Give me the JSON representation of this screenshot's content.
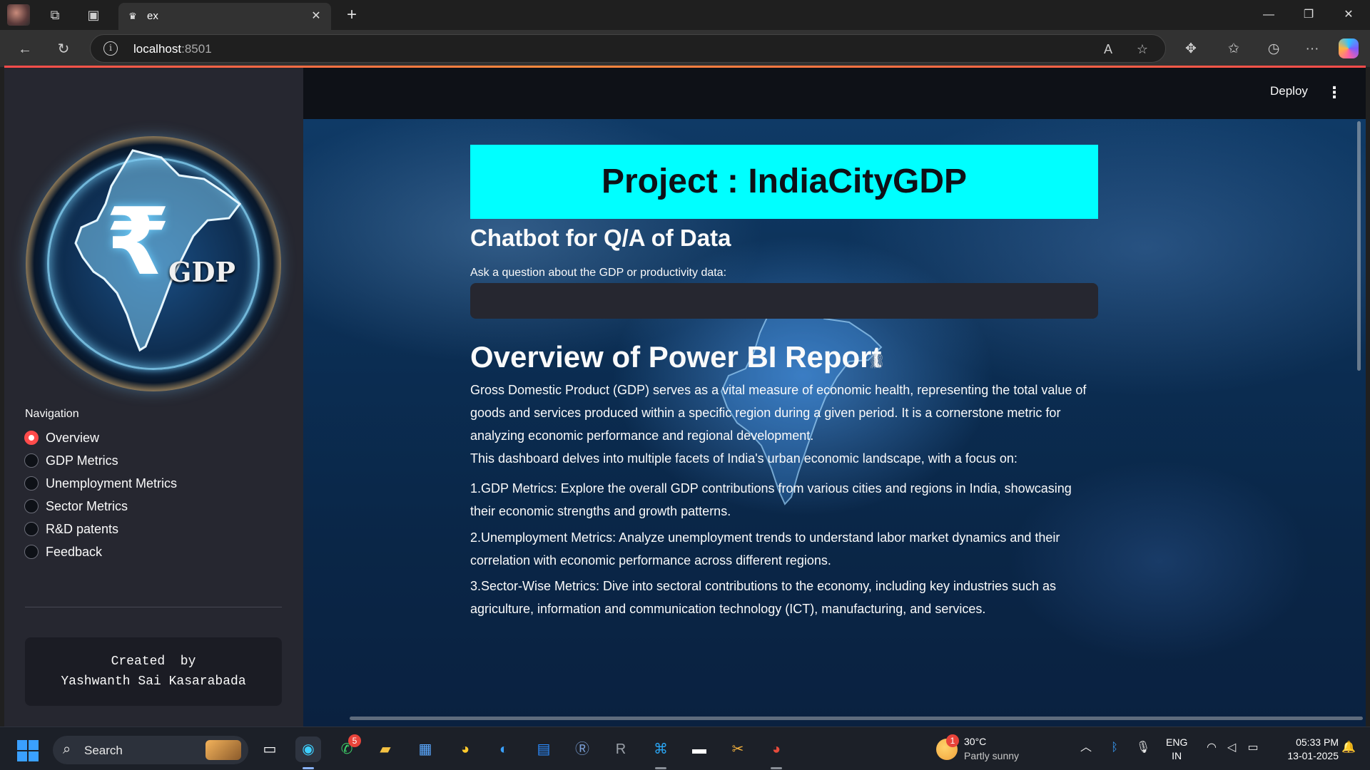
{
  "browser": {
    "tab_title": "ex",
    "url_host": "localhost",
    "url_port": ":8501",
    "tab_close_glyph": "✕",
    "new_tab_glyph": "+"
  },
  "header": {
    "deploy_label": "Deploy",
    "menu_glyph": "⋮"
  },
  "sidebar": {
    "logo_text": "GDP",
    "logo_symbol": "₹",
    "nav_label": "Navigation",
    "nav_items": [
      {
        "label": "Overview",
        "selected": true
      },
      {
        "label": "GDP Metrics",
        "selected": false
      },
      {
        "label": "Unemployment Metrics",
        "selected": false
      },
      {
        "label": "Sector Metrics",
        "selected": false
      },
      {
        "label": "R&D patents",
        "selected": false
      },
      {
        "label": "Feedback",
        "selected": false
      }
    ],
    "credit_line1": "Created  by",
    "credit_line2": "Yashwanth Sai Kasarabada"
  },
  "main": {
    "title": "Project : IndiaCityGDP",
    "chatbot_heading": "Chatbot for Q/A of Data",
    "input_label": "Ask a question about the GDP or productivity data:",
    "input_value": "",
    "overview_heading": "Overview of Power BI Report",
    "paragraphs": [
      "Gross Domestic Product (GDP) serves as a vital measure of economic health, representing the total value of goods and services produced within a specific region during a given period. It is a cornerstone metric for analyzing economic performance and regional development.",
      "This dashboard delves into multiple facets of India's urban economic landscape, with a focus on:",
      "1.GDP Metrics: Explore the overall GDP contributions from various cities and regions in India, showcasing their economic strengths and growth patterns.",
      "2.Unemployment Metrics: Analyze unemployment trends to understand labor market dynamics and their correlation with economic performance across different regions.",
      "3.Sector-Wise Metrics: Dive into sectoral contributions to the economy, including key industries such as agriculture, information and communication technology (ICT), manufacturing, and services."
    ]
  },
  "taskbar": {
    "search_label": "Search",
    "whatsapp_badge": "5",
    "weather_badge": "1",
    "weather_temp": "30°C",
    "weather_desc": "Partly sunny",
    "lang_line1": "ENG",
    "lang_line2": "IN",
    "time": "05:33 PM",
    "date": "13-01-2025"
  },
  "colors": {
    "accent": "#ff4b4b",
    "title_bg": "#00ffff",
    "sidebar_bg": "#262730",
    "app_bg": "#0e1117"
  }
}
